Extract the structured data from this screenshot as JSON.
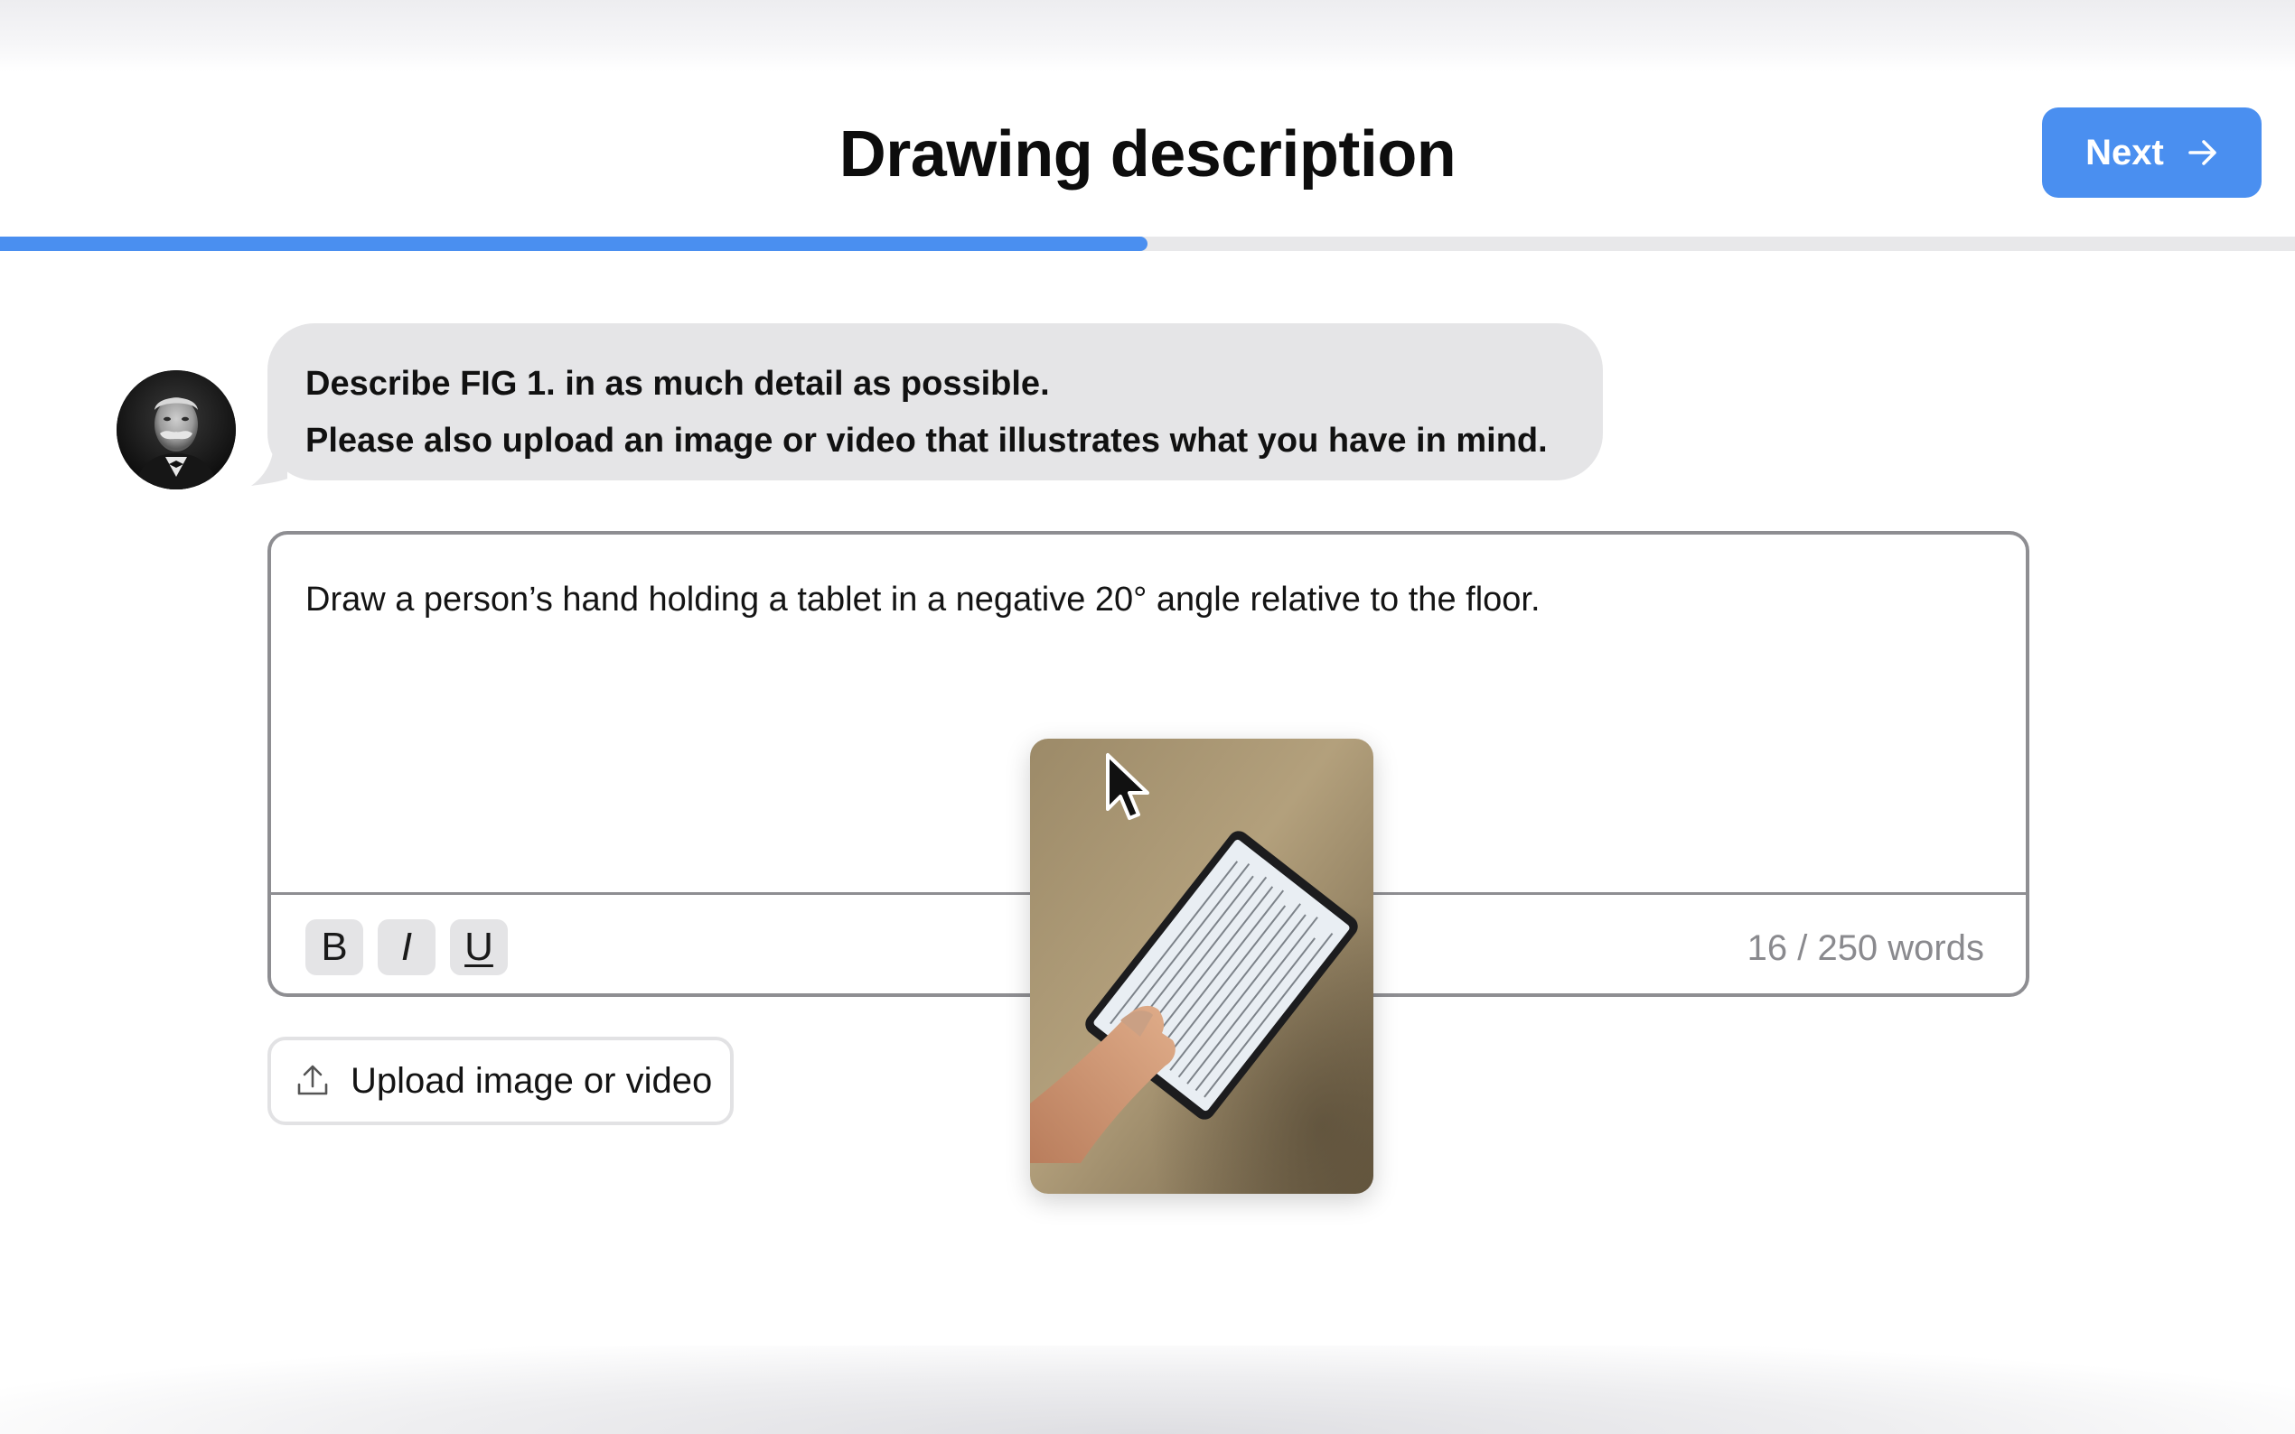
{
  "header": {
    "title": "Drawing description",
    "next_label": "Next",
    "next_icon": "arrow-right-icon"
  },
  "progress": {
    "value_percent": 50
  },
  "prompt": {
    "avatar": "portrait-avatar",
    "line1": "Describe FIG 1. in as much detail as possible.",
    "line2": "Please also upload an image or video that illustrates what you have in mind."
  },
  "editor": {
    "text": "Draw a person’s hand holding a tablet in a negative 20° angle relative to the floor.",
    "bold_label": "B",
    "italic_label": "I",
    "underline_label": "U",
    "word_count": "16 / 250 words"
  },
  "upload": {
    "label": "Upload image or video",
    "icon": "upload-icon"
  },
  "drag_preview": {
    "content": "hand-holding-tablet-photo"
  },
  "colors": {
    "accent": "#4a8ff0",
    "bubble": "#e5e5e7",
    "border": "#8e8e92",
    "muted_text": "#8a8a8e"
  }
}
